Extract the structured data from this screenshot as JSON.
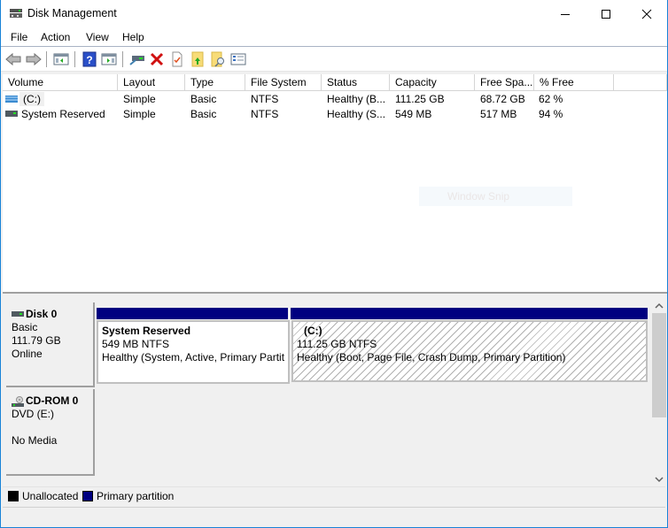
{
  "window": {
    "title": "Disk Management",
    "controls": {
      "minimize": "minimize",
      "maximize": "maximize",
      "close": "close"
    }
  },
  "menu": {
    "items": [
      {
        "label": "File"
      },
      {
        "label": "Action"
      },
      {
        "label": "View"
      },
      {
        "label": "Help"
      }
    ]
  },
  "toolbar": {
    "buttons": [
      "back-icon",
      "forward-icon",
      "show-hide-console-tree-icon",
      "help-icon",
      "show-hide-action-pane-icon",
      "connect-drive-icon",
      "delete-icon",
      "properties-icon",
      "up-folder-icon",
      "find-icon",
      "settings-list-icon"
    ]
  },
  "volume_list": {
    "columns": [
      "Volume",
      "Layout",
      "Type",
      "File System",
      "Status",
      "Capacity",
      "Free Spa...",
      "% Free"
    ],
    "rows": [
      {
        "volume": "(C:)",
        "layout": "Simple",
        "type": "Basic",
        "fs": "NTFS",
        "status": "Healthy (B...",
        "capacity": "111.25 GB",
        "free": "68.72 GB",
        "pct_free": "62 %"
      },
      {
        "volume": "System Reserved",
        "layout": "Simple",
        "type": "Basic",
        "fs": "NTFS",
        "status": "Healthy (S...",
        "capacity": "549 MB",
        "free": "517 MB",
        "pct_free": "94 %"
      }
    ],
    "overlay_text": "Window Snip"
  },
  "disks": [
    {
      "name": "Disk 0",
      "type": "Basic",
      "size": "111.79 GB",
      "state": "Online",
      "partitions": [
        {
          "name": "System Reserved",
          "size": "549 MB NTFS",
          "status": "Healthy (System, Active, Primary Partit"
        },
        {
          "name": "(C:)",
          "size": "111.25 GB NTFS",
          "status": "Healthy (Boot, Page File, Crash Dump, Primary Partition)"
        }
      ]
    },
    {
      "name": "CD-ROM 0",
      "type": "DVD (E:)",
      "state": "No Media"
    }
  ],
  "legend": {
    "items": [
      {
        "label": "Unallocated",
        "color": "#000000"
      },
      {
        "label": "Primary partition",
        "color": "#000080"
      }
    ]
  },
  "colors": {
    "primary_partition": "#000080",
    "unallocated": "#000000",
    "window_border": "#1883d7"
  }
}
